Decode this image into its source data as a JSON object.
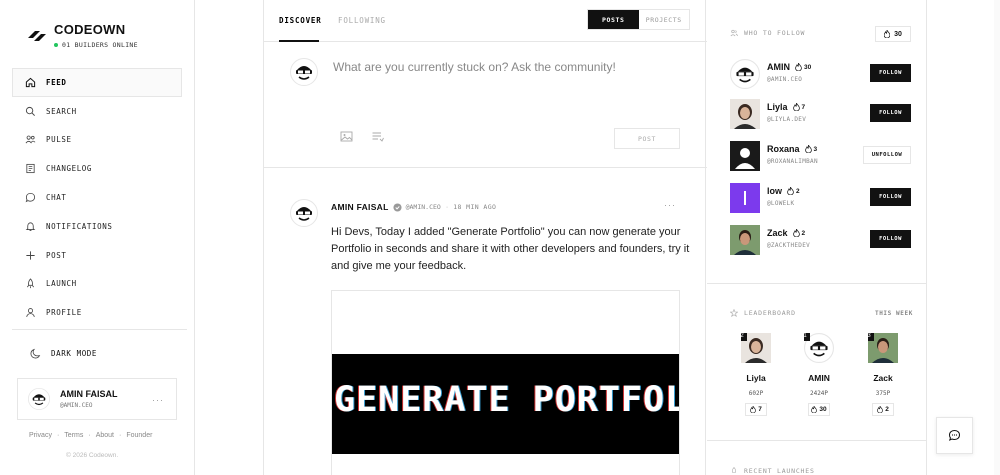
{
  "brand": {
    "name": "CODEOWN",
    "online": "01 BUILDERS ONLINE",
    "online_color": "#22c55e"
  },
  "nav": [
    {
      "label": "FEED",
      "icon": "home-icon",
      "active": true
    },
    {
      "label": "SEARCH",
      "icon": "search-icon"
    },
    {
      "label": "PULSE",
      "icon": "users-icon"
    },
    {
      "label": "CHANGELOG",
      "icon": "changelog-icon"
    },
    {
      "label": "CHAT",
      "icon": "chat-icon"
    },
    {
      "label": "NOTIFICATIONS",
      "icon": "bell-icon"
    },
    {
      "label": "POST",
      "icon": "plus-icon"
    },
    {
      "label": "LAUNCH",
      "icon": "rocket-icon"
    },
    {
      "label": "PROFILE",
      "icon": "user-icon"
    }
  ],
  "dark_mode": "DARK MODE",
  "current_user": {
    "name": "AMIN FAISAL",
    "handle": "@AMIN.CEO"
  },
  "footer": {
    "privacy": "Privacy",
    "terms": "Terms",
    "about": "About",
    "founder": "Founder",
    "dot": "·",
    "copyright": "© 2026 Codeown."
  },
  "tabs": {
    "discover": "DISCOVER",
    "following": "FOLLOWING"
  },
  "toggle": {
    "posts": "POSTS",
    "projects": "PROJECTS"
  },
  "composer": {
    "placeholder": "What are you currently stuck on? Ask the community!",
    "post": "POST"
  },
  "post": {
    "author": "AMIN FAISAL",
    "handle": "@AMIN.CEO",
    "separator": "·",
    "time": "18 MIN AGO",
    "more": "···",
    "text": "Hi Devs, Today I added \"Generate Portfolio\" you can now generate your Portfolio in seconds and share it with other developers and founders, try it and give me your feedback.",
    "image_text": "GENERATE PORTFOLIO"
  },
  "who_to_follow": {
    "title": "WHO TO FOLLOW",
    "count": "30",
    "people": [
      {
        "name": "AMIN",
        "points": "30",
        "handle": "@AMIN.CEO",
        "button": "FOLLOW"
      },
      {
        "name": "Liyla",
        "points": "7",
        "handle": "@LIYLA.DEV",
        "button": "FOLLOW"
      },
      {
        "name": "Roxana",
        "points": "3",
        "handle": "@ROXANALIMBAN",
        "button": "UNFOLLOW"
      },
      {
        "name": "low",
        "points": "2",
        "handle": "@LOWELK",
        "button": "FOLLOW"
      },
      {
        "name": "Zack",
        "points": "2",
        "handle": "@ZACKTHEDEV",
        "button": "FOLLOW"
      }
    ]
  },
  "leaderboard": {
    "title": "LEADERBOARD",
    "period": "THIS WEEK",
    "entries": [
      {
        "rank": "2",
        "name": "Liyla",
        "points": "602P",
        "streak": "7"
      },
      {
        "rank": "1",
        "name": "AMIN",
        "points": "2424P",
        "streak": "30"
      },
      {
        "rank": "3",
        "name": "Zack",
        "points": "375P",
        "streak": "2"
      }
    ]
  },
  "recent_launches": {
    "title": "RECENT LAUNCHES"
  },
  "colors": {
    "accent": "#111111",
    "border": "#e6e6e6",
    "purple": "#7c3aed"
  }
}
